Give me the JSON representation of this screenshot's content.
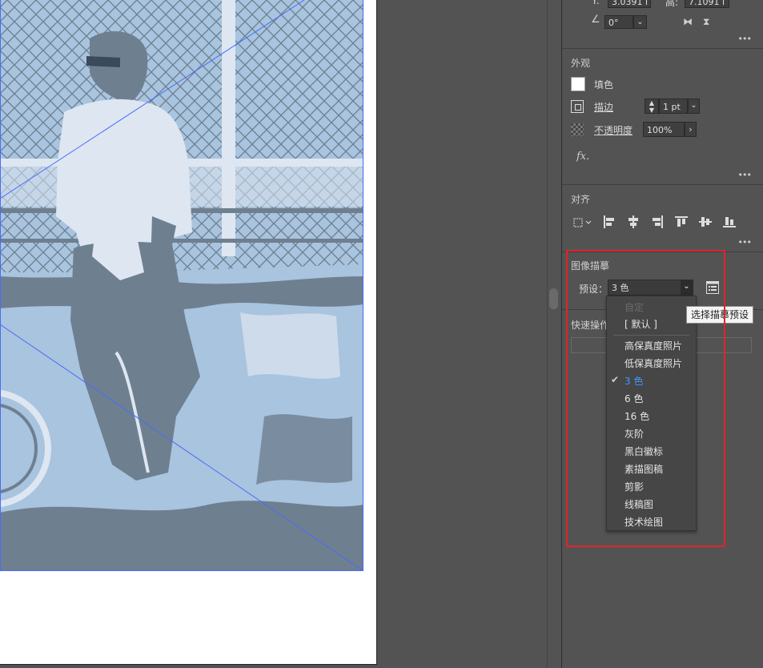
{
  "transform": {
    "y_label": "Y:",
    "y_value": "3.0391 i",
    "h_label": "高:",
    "h_value": "7.1091 i",
    "angle_value": "0°"
  },
  "appearance": {
    "title": "外观",
    "fill_label": "填色",
    "stroke_label": "描边",
    "stroke_value": "1 pt",
    "opacity_label": "不透明度",
    "opacity_value": "100%",
    "fx_label": "fx."
  },
  "align": {
    "title": "对齐"
  },
  "image_trace": {
    "title": "图像描摹",
    "preset_label": "预设：",
    "preset_value": "3 色",
    "tooltip": "选择描摹预设"
  },
  "quick_actions": {
    "title": "快速操作"
  },
  "preset_menu": {
    "items": [
      {
        "label": "自定",
        "disabled": true,
        "checked": false
      },
      {
        "label": "[ 默认 ]",
        "disabled": false,
        "checked": false
      },
      {
        "label": "高保真度照片",
        "disabled": false,
        "checked": false
      },
      {
        "label": "低保真度照片",
        "disabled": false,
        "checked": false
      },
      {
        "label": "3 色",
        "disabled": false,
        "checked": true
      },
      {
        "label": "6 色",
        "disabled": false,
        "checked": false
      },
      {
        "label": "16 色",
        "disabled": false,
        "checked": false
      },
      {
        "label": "灰阶",
        "disabled": false,
        "checked": false
      },
      {
        "label": "黑白徽标",
        "disabled": false,
        "checked": false
      },
      {
        "label": "素描图稿",
        "disabled": false,
        "checked": false
      },
      {
        "label": "剪影",
        "disabled": false,
        "checked": false
      },
      {
        "label": "线稿图",
        "disabled": false,
        "checked": false
      },
      {
        "label": "技术绘图",
        "disabled": false,
        "checked": false
      }
    ]
  },
  "colors": {
    "panel_bg": "#535353",
    "trace_light": "#a8c4de",
    "trace_mid": "#6e7f90",
    "trace_pale": "#dde6f1",
    "selection": "#4a6cf7",
    "highlight": "#e0242c",
    "checked_text": "#3e9bff"
  }
}
